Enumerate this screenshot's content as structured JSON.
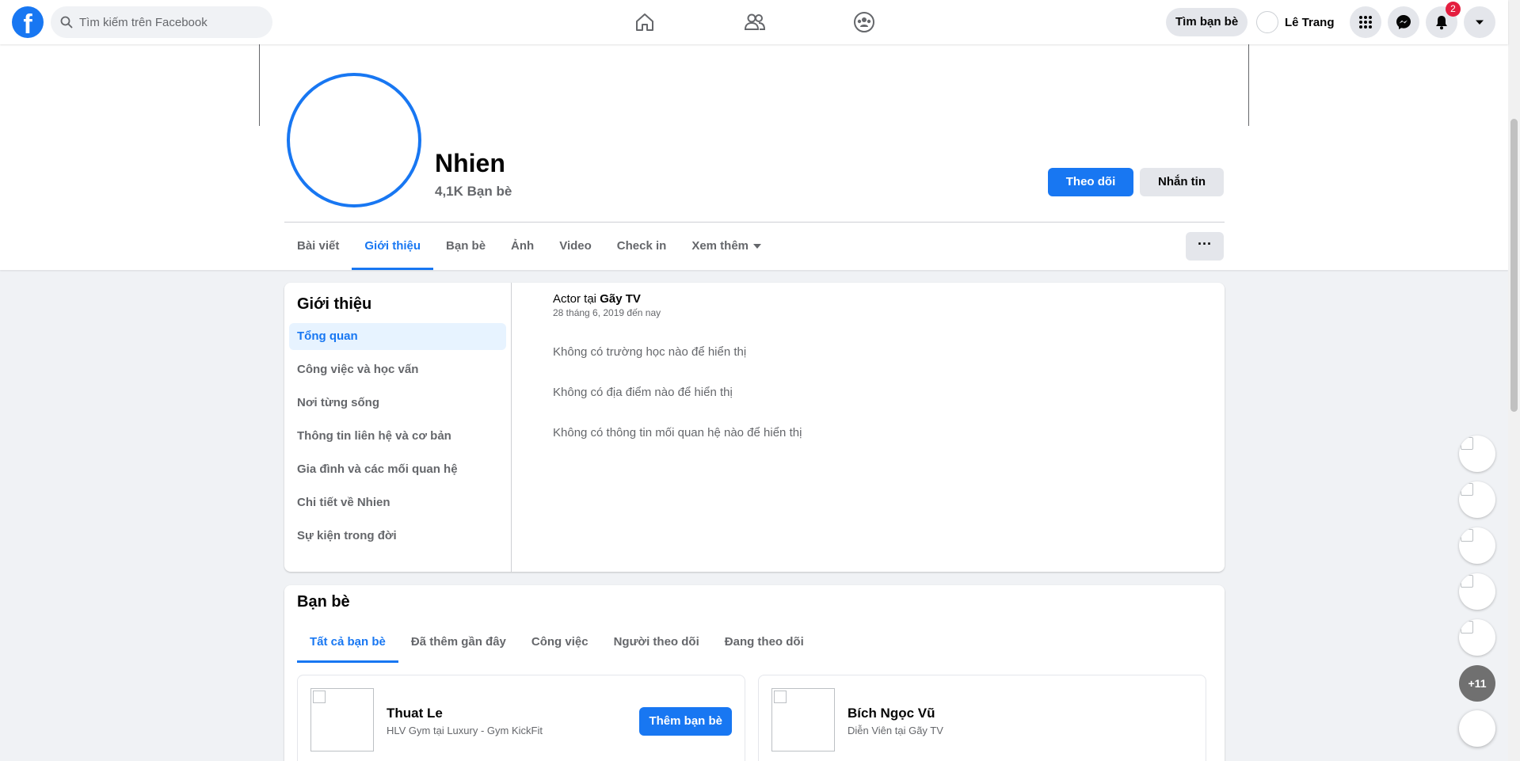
{
  "search": {
    "placeholder": "Tìm kiếm trên Facebook"
  },
  "header": {
    "find_friends": "Tìm bạn bè",
    "user_name": "Lê Trang",
    "notification_count": "2"
  },
  "profile": {
    "name": "Nhien",
    "friends_count": "4,1K Bạn bè",
    "follow_label": "Theo dõi",
    "message_label": "Nhắn tin",
    "more_label": "···",
    "tabs": [
      {
        "label": "Bài viết"
      },
      {
        "label": "Giới thiệu"
      },
      {
        "label": "Bạn bè"
      },
      {
        "label": "Ảnh"
      },
      {
        "label": "Video"
      },
      {
        "label": "Check in"
      },
      {
        "label": "Xem thêm"
      }
    ],
    "active_tab": "Giới thiệu"
  },
  "intro": {
    "title": "Giới thiệu",
    "menu": [
      {
        "label": "Tổng quan"
      },
      {
        "label": "Công việc và học vấn"
      },
      {
        "label": "Nơi từng sống"
      },
      {
        "label": "Thông tin liên hệ và cơ bản"
      },
      {
        "label": "Gia đình và các mối quan hệ"
      },
      {
        "label": "Chi tiết về Nhien"
      },
      {
        "label": "Sự kiện trong đời"
      }
    ],
    "work_prefix": "Actor tại ",
    "work_place": "Gãy TV",
    "work_date": "28 tháng 6, 2019 đến nay",
    "no_school": "Không có trường học nào để hiển thị",
    "no_places": "Không có địa điểm nào để hiển thị",
    "no_relationship": "Không có thông tin mối quan hệ nào để hiển thị"
  },
  "friends": {
    "title": "Bạn bè",
    "tabs": [
      {
        "label": "Tất cả bạn bè"
      },
      {
        "label": "Đã thêm gần đây"
      },
      {
        "label": "Công việc"
      },
      {
        "label": "Người theo dõi"
      },
      {
        "label": "Đang theo dõi"
      }
    ],
    "list": [
      {
        "name": "Thuat Le",
        "desc": "HLV Gym tại Luxury - Gym KickFit",
        "action": "Thêm bạn bè"
      },
      {
        "name": "Bích Ngọc Vũ",
        "desc": "Diễn Viên tại Gãy TV"
      }
    ]
  },
  "contacts": {
    "more_label": "+11"
  },
  "colors": {
    "accent": "#1877f2",
    "background": "#f0f2f5",
    "badge": "#e41e3f"
  }
}
